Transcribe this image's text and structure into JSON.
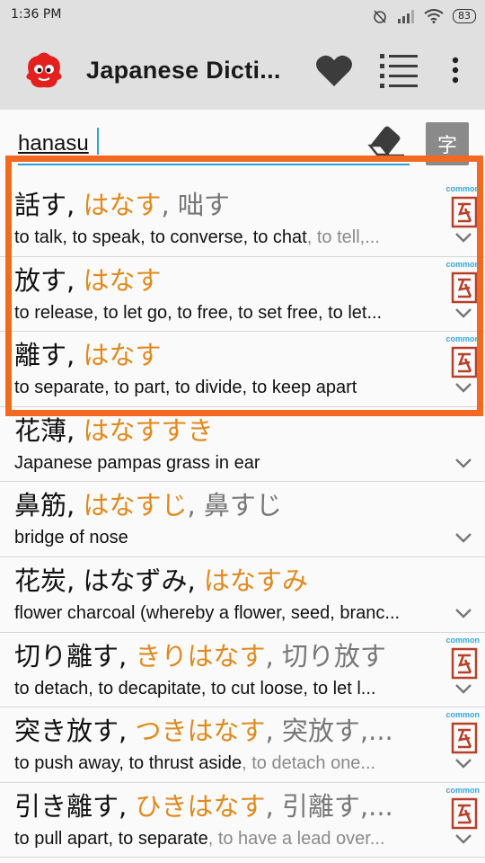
{
  "status": {
    "time": "1:36 PM",
    "battery": "83"
  },
  "appbar": {
    "title": "Japanese Dicti..."
  },
  "search": {
    "value": "hanasu",
    "kanji_button": "字"
  },
  "results": [
    {
      "kanji": "話す",
      "reading": "はなす",
      "alt": ", 咄す",
      "def_main": "to talk, to speak, to converse, to chat",
      "def_extra": ", to tell,...",
      "common": "common"
    },
    {
      "kanji": "放す",
      "reading": "はなす",
      "alt": "",
      "def_main": "to release, to let go, to free, to set free, to let...",
      "def_extra": "",
      "common": "common"
    },
    {
      "kanji": "離す",
      "reading": "はなす",
      "alt": "",
      "def_main": "to separate, to part, to divide, to keep apart",
      "def_extra": "",
      "common": "common"
    },
    {
      "kanji": "花薄",
      "reading": "はなすすき",
      "alt": "",
      "def_main": "Japanese pampas grass in ear",
      "def_extra": "",
      "common": ""
    },
    {
      "kanji": "鼻筋",
      "reading": "はなすじ",
      "alt": ", 鼻すじ",
      "def_main": "bridge of nose",
      "def_extra": "",
      "common": ""
    },
    {
      "kanji": "花炭",
      "reading_plain": "はなずみ",
      "reading": "はなすみ",
      "alt": "",
      "def_main": "flower charcoal (whereby a flower, seed, branc...",
      "def_extra": "",
      "common": ""
    },
    {
      "kanji": "切り離す",
      "reading": "きりはなす",
      "alt": ", 切り放す",
      "def_main": "to detach, to decapitate, to cut loose, to let l...",
      "def_extra": "",
      "common": "common"
    },
    {
      "kanji": "突き放す",
      "reading": "つきはなす",
      "alt": ", 突放す,...",
      "def_main": "to push away, to thrust aside",
      "def_extra": ", to detach one...",
      "common": "common"
    },
    {
      "kanji": "引き離す",
      "reading": "ひきはなす",
      "alt": ", 引離す,...",
      "def_main": "to pull apart, to separate",
      "def_extra": ", to have a lead over...",
      "common": "common"
    }
  ],
  "colors": {
    "reading": "#e08a1e",
    "highlight": "#f26a21",
    "accent": "#29a3d6"
  }
}
